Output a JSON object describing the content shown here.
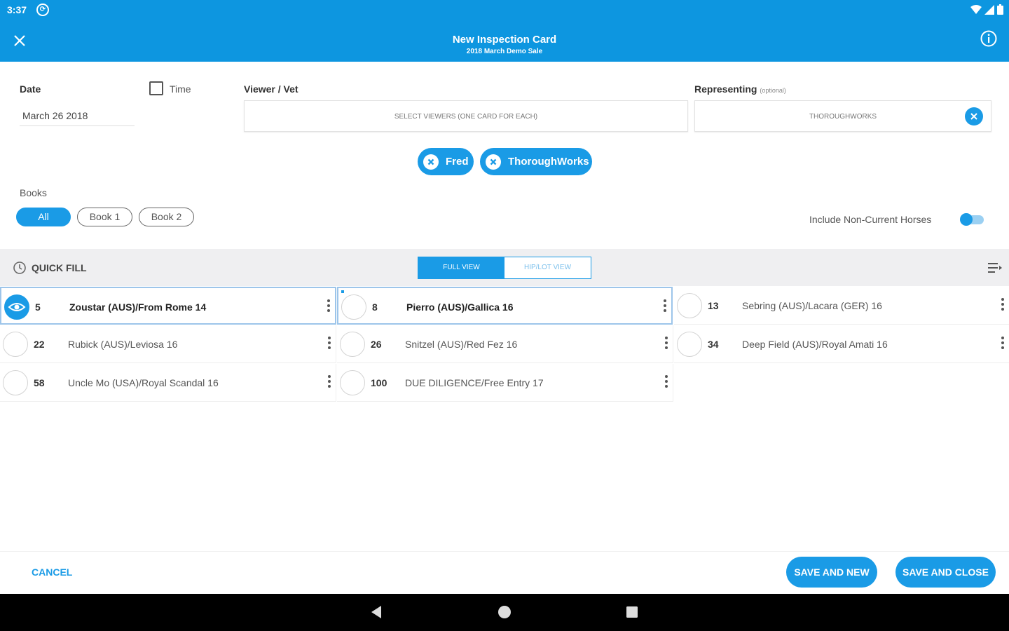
{
  "status_bar": {
    "time": "3:37"
  },
  "header": {
    "title": "New Inspection Card",
    "subtitle": "2018 March Demo Sale"
  },
  "form": {
    "date_label": "Date",
    "date_value": "March 26 2018",
    "time_label": "Time",
    "viewer_label": "Viewer / Vet",
    "viewer_placeholder": "SELECT VIEWERS (ONE CARD FOR EACH)",
    "representing_label": "Representing",
    "representing_optional": "(optional)",
    "representing_value": "THOROUGHWORKS",
    "chips": [
      "Fred",
      "ThoroughWorks"
    ],
    "books_label": "Books",
    "books": [
      "All",
      "Book 1",
      "Book 2"
    ],
    "include_label": "Include Non-Current Horses"
  },
  "quick_fill": {
    "label": "QUICK FILL",
    "view_full": "FULL VIEW",
    "view_hip": "HIP/LOT VIEW"
  },
  "horses": [
    {
      "num": "5",
      "name": "Zoustar (AUS)/From Rome 14"
    },
    {
      "num": "8",
      "name": "Pierro (AUS)/Gallica 16"
    },
    {
      "num": "13",
      "name": "Sebring (AUS)/Lacara (GER) 16"
    },
    {
      "num": "22",
      "name": "Rubick (AUS)/Leviosa 16"
    },
    {
      "num": "26",
      "name": "Snitzel (AUS)/Red Fez 16"
    },
    {
      "num": "34",
      "name": "Deep Field (AUS)/Royal Amati 16"
    },
    {
      "num": "58",
      "name": "Uncle Mo (USA)/Royal Scandal 16"
    },
    {
      "num": "100",
      "name": "DUE DILIGENCE/Free Entry 17"
    }
  ],
  "actions": {
    "cancel": "CANCEL",
    "save_new": "SAVE AND NEW",
    "save_close": "SAVE AND CLOSE"
  },
  "colors": {
    "primary": "#1a9be6",
    "appbar": "#0d96e0"
  }
}
